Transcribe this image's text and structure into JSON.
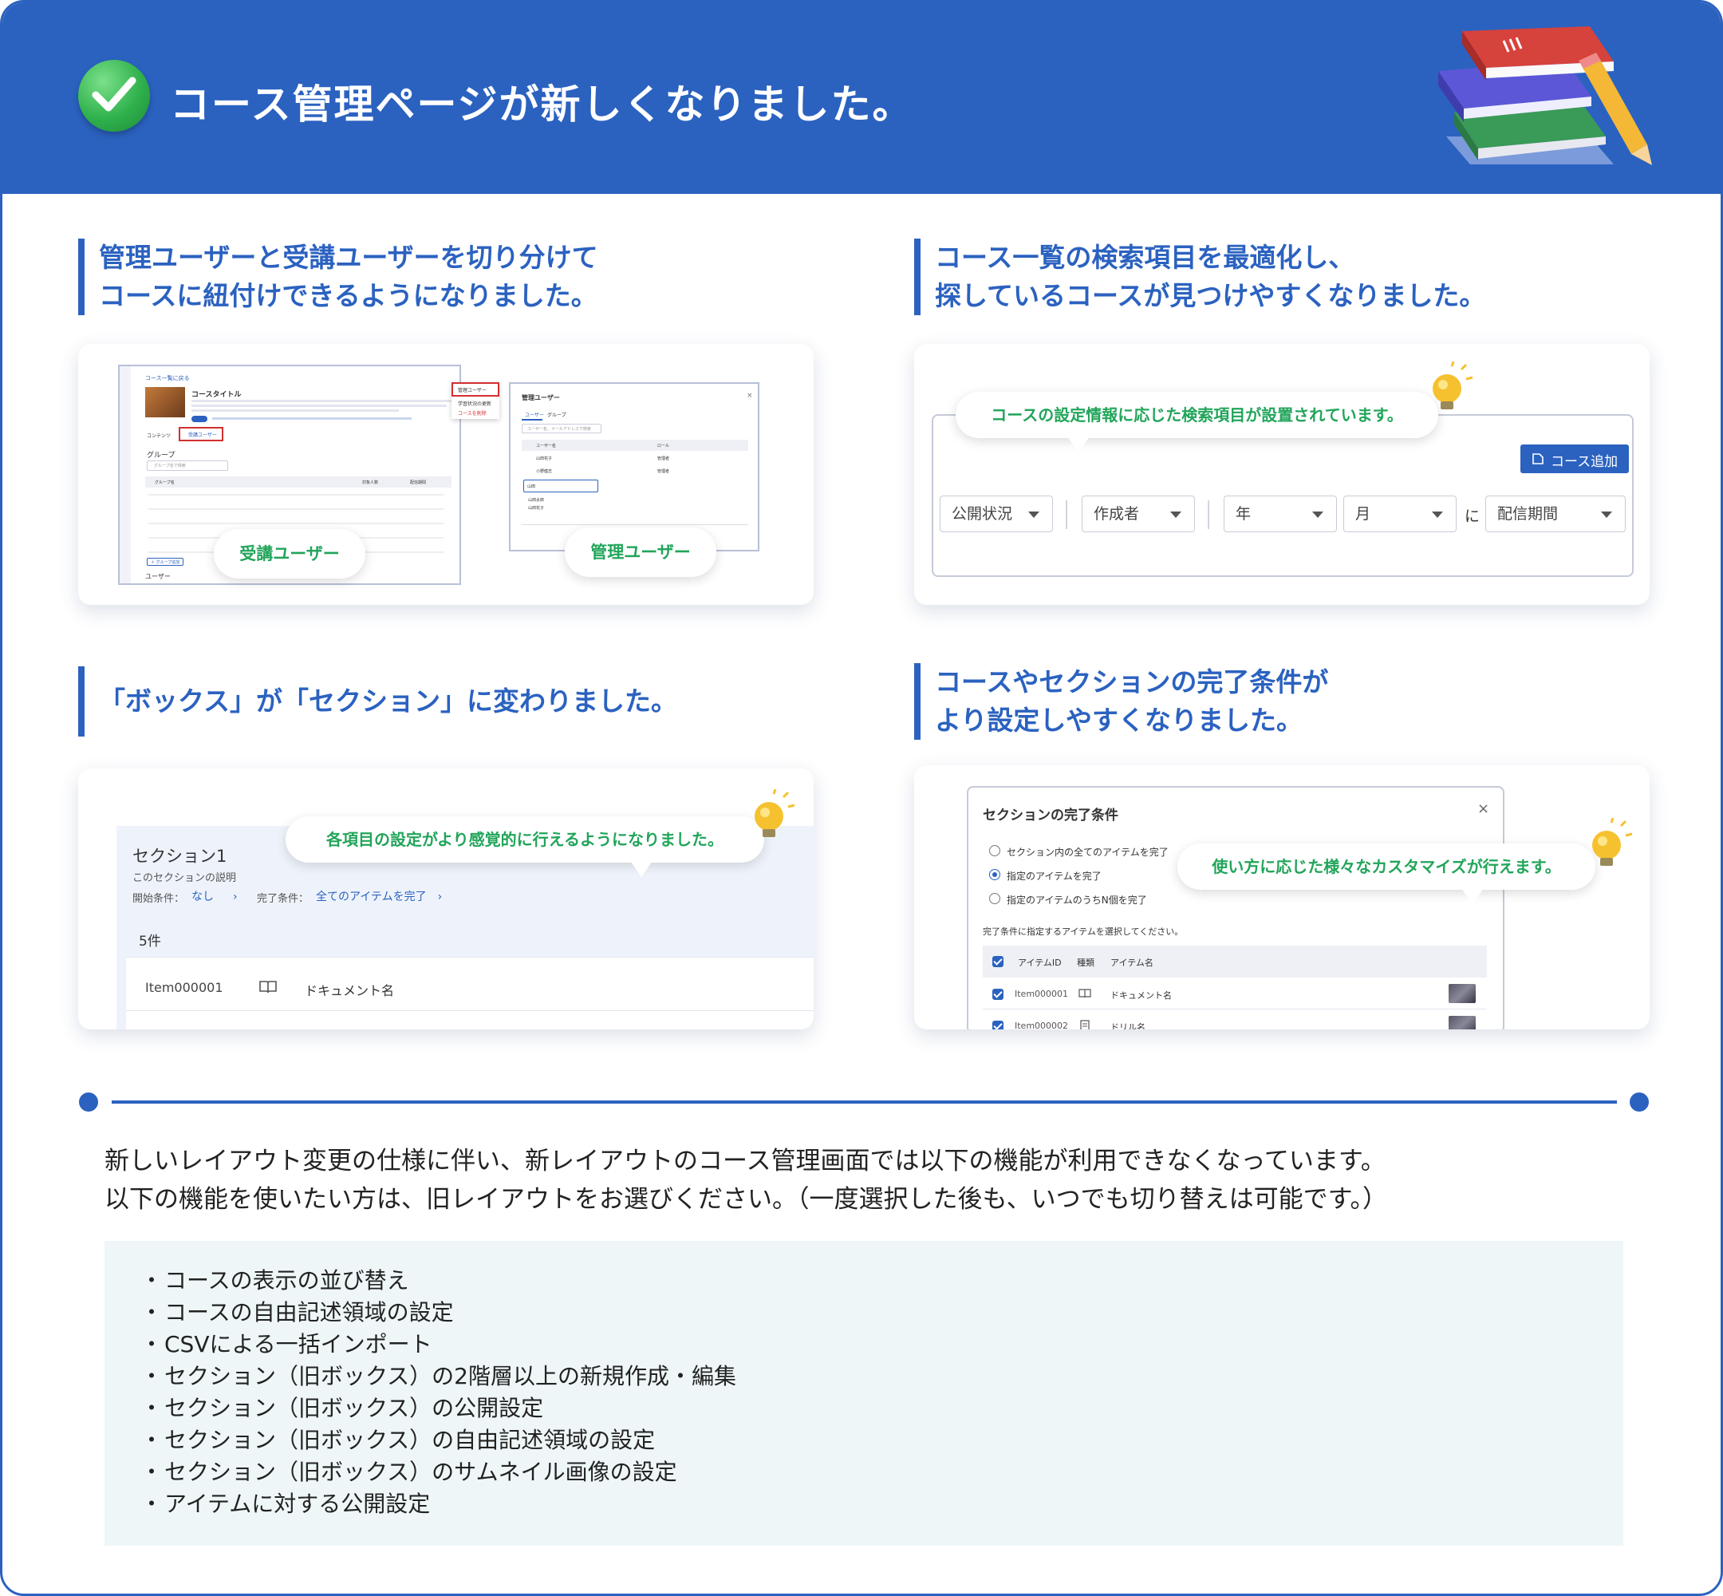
{
  "header": {
    "title": "コース管理ページが新しくなりました。"
  },
  "features": [
    {
      "heading": [
        "管理ユーザーと受講ユーザーを切り分けて",
        "コースに紐付けできるようになりました。"
      ]
    },
    {
      "heading": [
        "コース一覧の検索項目を最適化し、",
        "探しているコースが見つけやすくなりました。"
      ]
    },
    {
      "heading": [
        "「ボックス」が「セクション」に変わりました。"
      ]
    },
    {
      "heading": [
        "コースやセクションの完了条件が",
        "より設定しやすくなりました。"
      ]
    }
  ],
  "card1": {
    "back_link": "コース一覧に戻る",
    "course_title": "コースタイトル",
    "menu_items": [
      "管理ユーザー",
      "学習状況の更新",
      "コースを削除"
    ],
    "tabs": [
      "コンテンツ",
      "受講ユーザー"
    ],
    "group_label": "グループ",
    "group_search": "グループ名で検索",
    "columns": [
      "グループ名",
      "対象人数",
      "配信期間"
    ],
    "users_label": "ユーザー",
    "add_group": "＋ グループ追加",
    "dialog_title": "管理ユーザー",
    "dialog_tabs": [
      "ユーザー",
      "グループ"
    ],
    "dialog_search": "ユーザー名、メールアドレスで検索",
    "dialog_columns": [
      "ユーザー名",
      "ロール"
    ],
    "dialog_rows": [
      {
        "name": "山田花子",
        "role": "管理者"
      },
      {
        "name": "小野健志",
        "role": "管理者"
      }
    ],
    "dialog_select": "山田",
    "dialog_options": [
      "山田太郎",
      "山田花子"
    ],
    "pill_learner": "受講ユーザー",
    "pill_admin": "管理ユーザー"
  },
  "card2": {
    "callout": "コースの設定情報に応じた検索項目が設置されています。",
    "add_button": "コース追加",
    "filters": [
      "公開状況",
      "作成者",
      "年",
      "月"
    ],
    "connector": "に",
    "period_filter": "配信期間"
  },
  "card3": {
    "callout": "各項目の設定がより感覚的に行えるようになりました。",
    "section_title": "セクション1",
    "section_desc": "このセクションの説明",
    "start_label": "開始条件：",
    "start_value": "なし",
    "complete_label": "完了条件：",
    "complete_value": "全てのアイテムを完了",
    "count": "5件",
    "item_id": "Item000001",
    "item_name": "ドキュメント名"
  },
  "card4": {
    "dialog_title": "セクションの完了条件",
    "options": [
      "セクション内の全てのアイテムを完了",
      "指定のアイテムを完了",
      "指定のアイテムのうちN個を完了"
    ],
    "instruction": "完了条件に指定するアイテムを選択してください。",
    "columns": [
      "アイテムID",
      "種類",
      "アイテム名"
    ],
    "rows": [
      {
        "id": "Item000001",
        "name": "ドキュメント名"
      },
      {
        "id": "Item000002",
        "name": "ドリル名"
      }
    ],
    "callout": "使い方に応じた様々なカスタマイズが行えます。"
  },
  "notice": {
    "line1": "新しいレイアウト変更の仕様に伴い、新レイアウトのコース管理画面では以下の機能が利用できなくなっています。",
    "line2": "以下の機能を使いたい方は、旧レイアウトをお選びください。（一度選択した後も、いつでも切り替えは可能です。）"
  },
  "unavailable_features": [
    "コースの表示の並び替え",
    "コースの自由記述領域の設定",
    "CSVによる一括インポート",
    "セクション（旧ボックス）の2階層以上の新規作成・編集",
    "セクション（旧ボックス）の公開設定",
    "セクション（旧ボックス）の自由記述領域の設定",
    "セクション（旧ボックス）のサムネイル画像の設定",
    "アイテムに対する公開設定"
  ],
  "colors": {
    "brand_blue": "#2B62C0",
    "accent_green": "#21A55A",
    "highlight_red": "#D32F2F",
    "list_bg": "#EEF6F8"
  },
  "icons": [
    "check-circle-icon",
    "books-pencil-icon",
    "lightbulb-icon",
    "document-icon",
    "drill-icon",
    "close-icon",
    "dropdown-caret-icon",
    "add-course-icon"
  ]
}
